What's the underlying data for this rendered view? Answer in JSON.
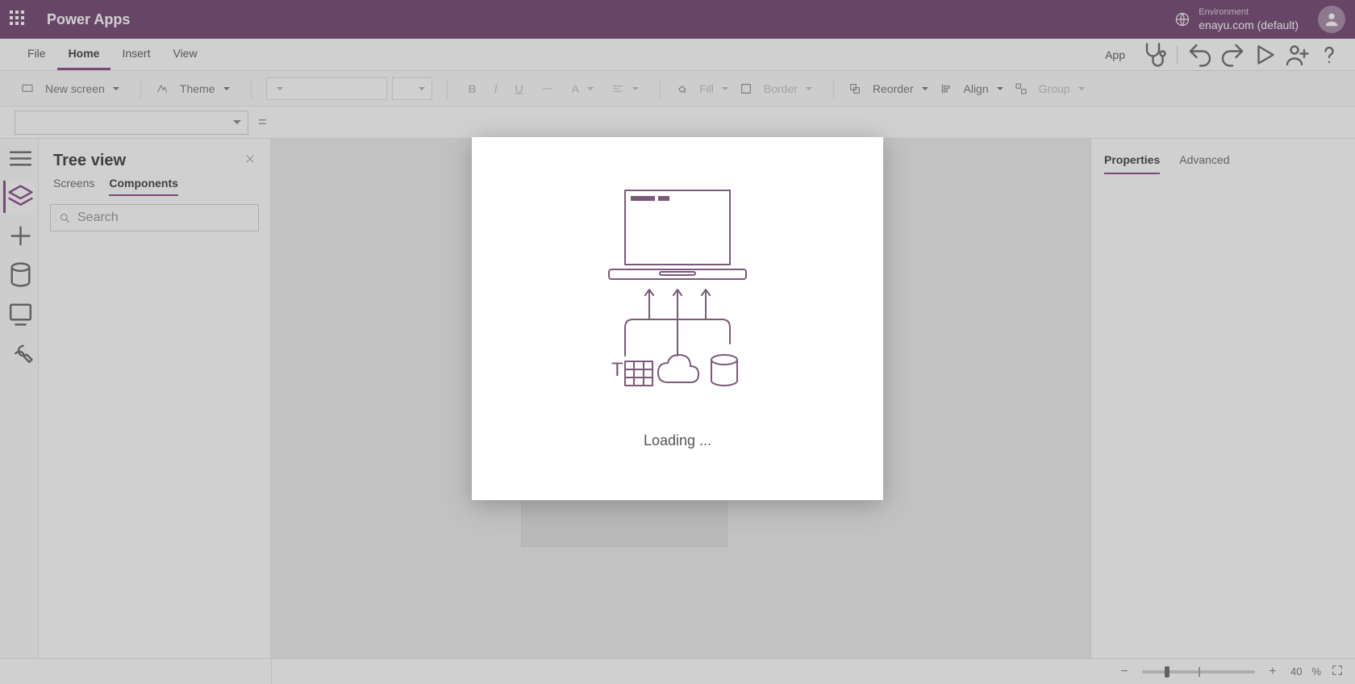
{
  "titlebar": {
    "app_name": "Power Apps",
    "environment_label": "Environment",
    "environment_value": "enayu.com (default)"
  },
  "menubar": {
    "items": [
      "File",
      "Home",
      "Insert",
      "View"
    ],
    "active_index": 1,
    "app_button": "App"
  },
  "ribbon": {
    "new_screen": "New screen",
    "theme": "Theme",
    "fill": "Fill",
    "border": "Border",
    "reorder": "Reorder",
    "align": "Align",
    "group": "Group"
  },
  "formula": {
    "equals": "="
  },
  "tree": {
    "title": "Tree view",
    "tabs": [
      "Screens",
      "Components"
    ],
    "active_tab": 1,
    "search_placeholder": "Search"
  },
  "right": {
    "tabs": [
      "Properties",
      "Advanced"
    ],
    "active_tab": 0
  },
  "status": {
    "zoom_value": "40",
    "zoom_suffix": "%"
  },
  "modal": {
    "loading": "Loading ..."
  },
  "icons": {
    "waffle": "waffle-icon",
    "health": "stethoscope-icon",
    "undo": "undo-icon",
    "redo": "redo-icon",
    "play": "play-icon",
    "share": "share-icon",
    "help": "help-icon"
  },
  "colors": {
    "brand": "#5e2a5e",
    "accent": "#7a2f7a"
  }
}
